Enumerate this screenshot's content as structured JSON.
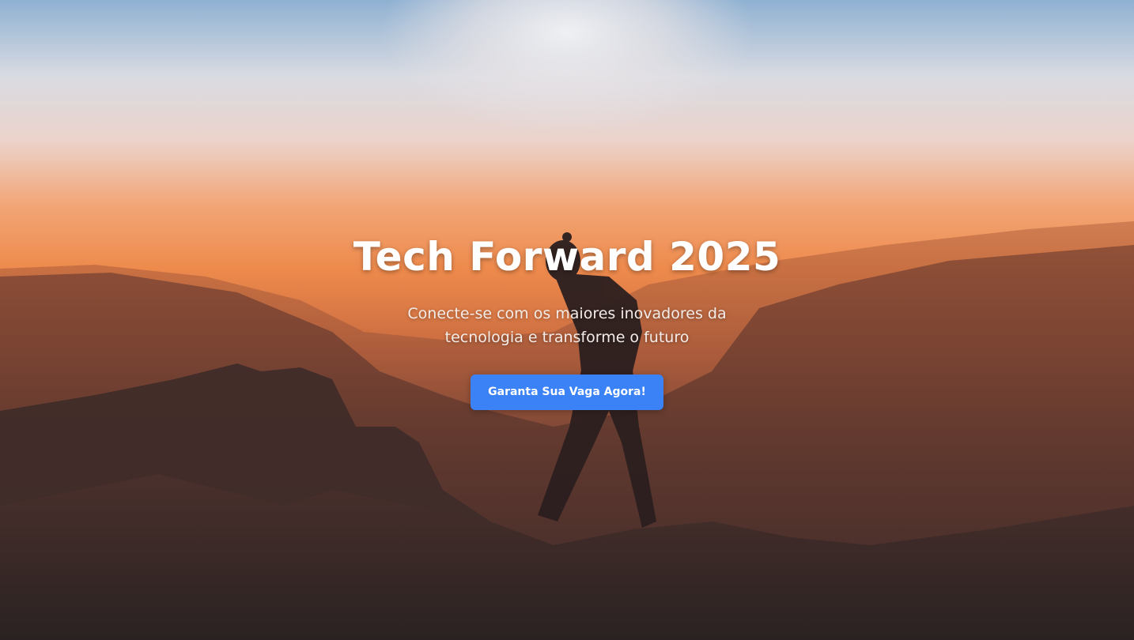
{
  "hero": {
    "title": "Tech Forward 2025",
    "subtitle": "Conecte-se com os maiores inovadores da tecnologia e transforme o futuro",
    "cta_label": "Garanta Sua Vaga Agora!"
  },
  "colors": {
    "cta_background": "#3b82f6",
    "text": "#ffffff",
    "sky_top": "#8fb0d0",
    "sunset_orange": "#f08a4b",
    "mountain_dark": "#2b2222"
  }
}
